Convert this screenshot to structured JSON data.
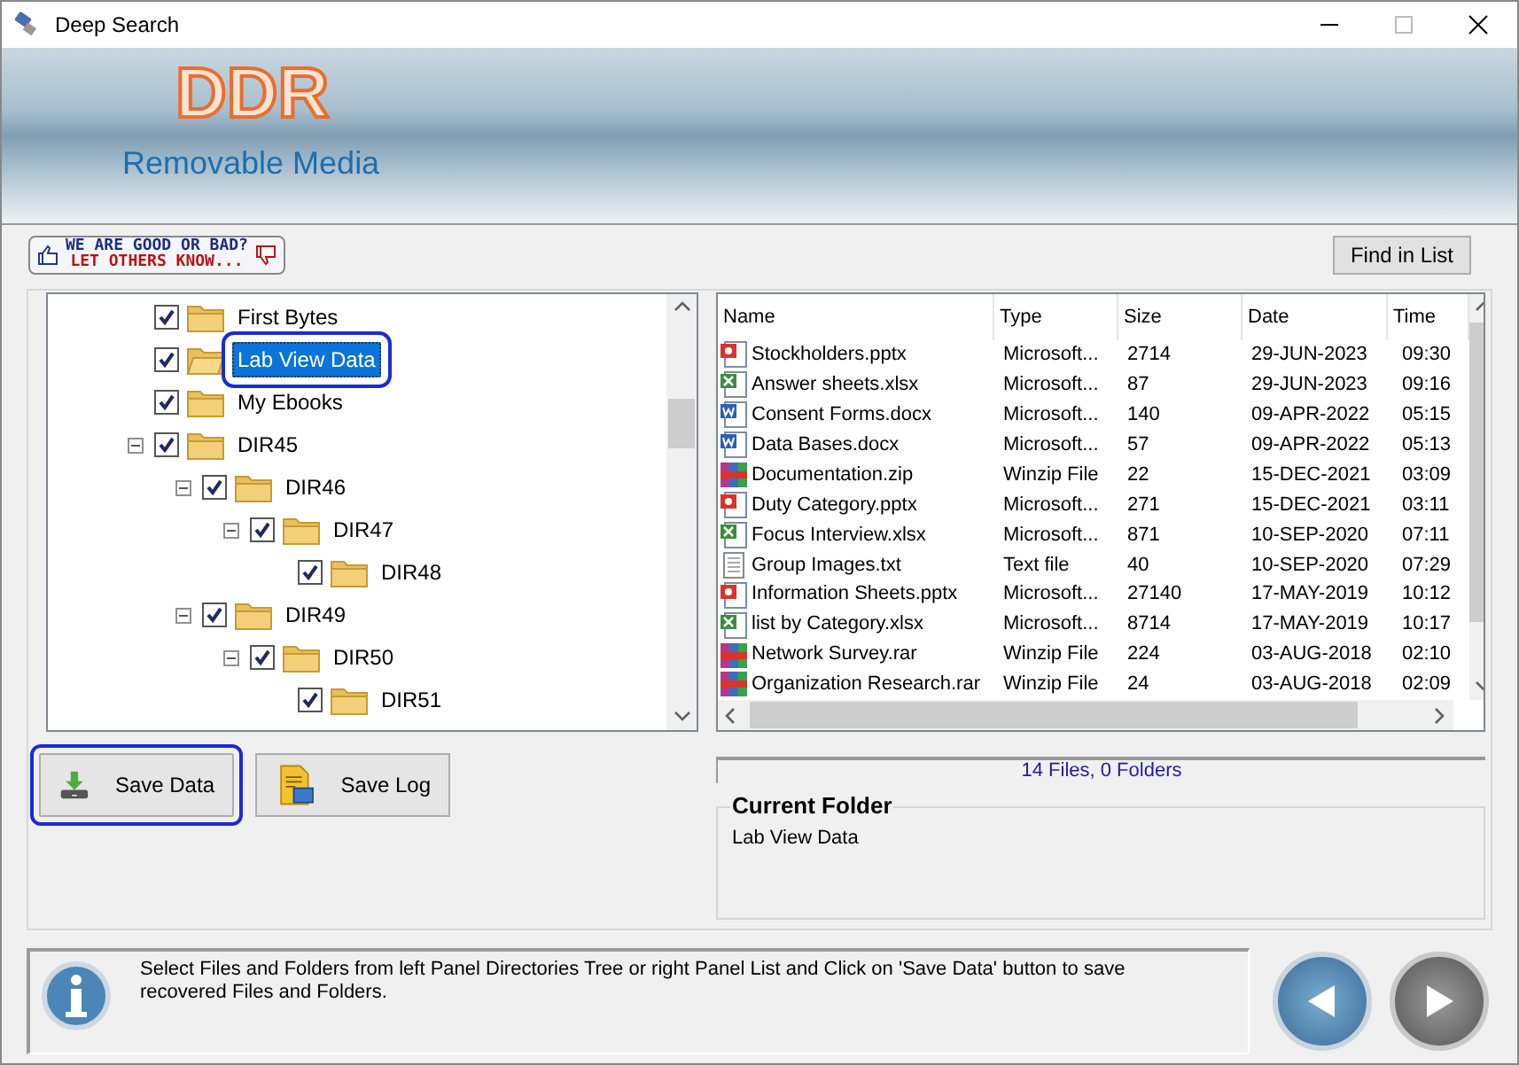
{
  "window": {
    "title": "Deep Search"
  },
  "banner": {
    "logo": "DDR",
    "subtitle": "Removable Media"
  },
  "feedback": {
    "line_1": "WE ARE GOOD OR BAD?",
    "line_2": "LET OTHERS KNOW..."
  },
  "find_button": "Find in List",
  "tree": [
    {
      "label": "First Bytes",
      "checked": true,
      "selected": false
    },
    {
      "label": "Lab View Data",
      "checked": true,
      "selected": true
    },
    {
      "label": "My Ebooks",
      "checked": true,
      "selected": false
    },
    {
      "label": "DIR45",
      "checked": true,
      "selected": false,
      "expanded": true,
      "children": [
        {
          "label": "DIR46",
          "checked": true,
          "selected": false,
          "expanded": true,
          "children": [
            {
              "label": "DIR47",
              "checked": true,
              "selected": false,
              "expanded": true,
              "children": [
                {
                  "label": "DIR48",
                  "checked": true,
                  "selected": false
                }
              ]
            }
          ]
        },
        {
          "label": "DIR49",
          "checked": true,
          "selected": false,
          "expanded": true,
          "children": [
            {
              "label": "DIR50",
              "checked": true,
              "selected": false,
              "expanded": true,
              "children": [
                {
                  "label": "DIR51",
                  "checked": true,
                  "selected": false
                }
              ]
            }
          ]
        }
      ]
    }
  ],
  "table": {
    "columns": [
      "Name",
      "Type",
      "Size",
      "Date",
      "Time"
    ],
    "rows": [
      {
        "kind": "powerpoint",
        "cells": [
          "Stockholders.pptx",
          "Microsoft...",
          "2714",
          "29-JUN-2023",
          "09:30"
        ]
      },
      {
        "kind": "excel",
        "cells": [
          "Answer sheets.xlsx",
          "Microsoft...",
          "87",
          "29-JUN-2023",
          "09:16"
        ]
      },
      {
        "kind": "word",
        "cells": [
          "Consent Forms.docx",
          "Microsoft...",
          "140",
          "09-APR-2022",
          "05:15"
        ]
      },
      {
        "kind": "word",
        "cells": [
          "Data Bases.docx",
          "Microsoft...",
          "57",
          "09-APR-2022",
          "05:13"
        ]
      },
      {
        "kind": "archive",
        "cells": [
          "Documentation.zip",
          "Winzip File",
          "22",
          "15-DEC-2021",
          "03:09"
        ]
      },
      {
        "kind": "powerpoint",
        "cells": [
          "Duty Category.pptx",
          "Microsoft...",
          "271",
          "15-DEC-2021",
          "03:11"
        ]
      },
      {
        "kind": "excel",
        "cells": [
          "Focus Interview.xlsx",
          "Microsoft...",
          "871",
          "10-SEP-2020",
          "07:11"
        ]
      },
      {
        "kind": "text",
        "cells": [
          "Group Images.txt",
          "Text file",
          "40",
          "10-SEP-2020",
          "07:29"
        ]
      },
      {
        "kind": "powerpoint",
        "cells": [
          "Information Sheets.pptx",
          "Microsoft...",
          "27140",
          "17-MAY-2019",
          "10:12"
        ]
      },
      {
        "kind": "excel",
        "cells": [
          "list by Category.xlsx",
          "Microsoft...",
          "8714",
          "17-MAY-2019",
          "10:17"
        ]
      },
      {
        "kind": "archive",
        "cells": [
          "Network Survey.rar",
          "Winzip File",
          "224",
          "03-AUG-2018",
          "02:10"
        ]
      },
      {
        "kind": "archive",
        "cells": [
          "Organization Research.rar",
          "Winzip File",
          "24",
          "03-AUG-2018",
          "02:09"
        ]
      }
    ]
  },
  "buttons": [
    {
      "kind": "save",
      "label": "Save Data",
      "highlighted": true
    },
    {
      "kind": "log",
      "label": "Save Log",
      "highlighted": false
    }
  ],
  "file_count": "14 Files, 0 Folders",
  "current_folder": {
    "title": "Current Folder",
    "value": "Lab View Data"
  },
  "hint": "Select Files and Folders from left Panel Directories Tree or right Panel List and Click on 'Save Data' button to save recovered Files and Folders."
}
